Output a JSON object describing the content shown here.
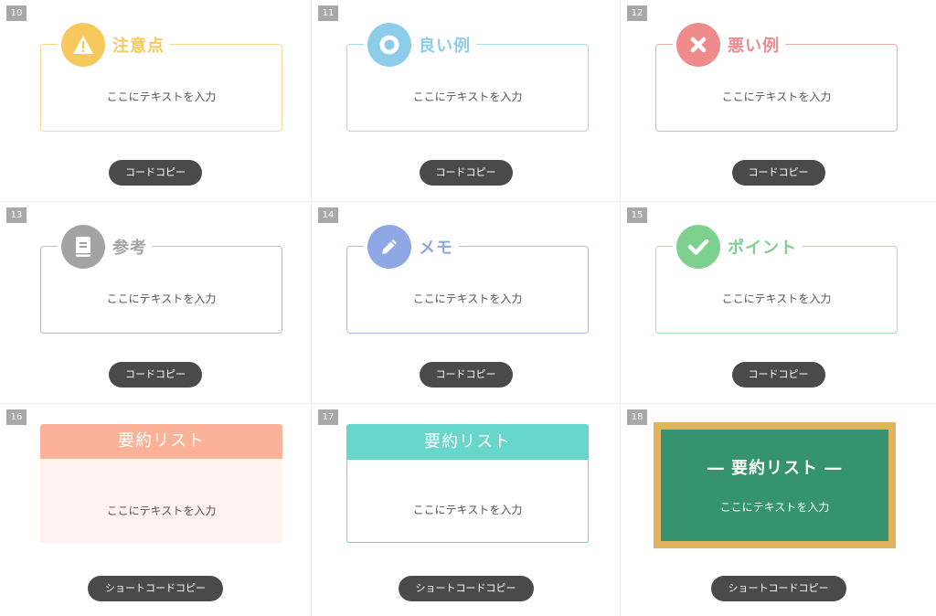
{
  "colors": {
    "caution": "#f7c95c",
    "good": "#8dcde9",
    "bad": "#ef8b8b",
    "reference": "#a3a3a3",
    "memo": "#8ea8e6",
    "point": "#7ed08e",
    "summary_salmon": "#fcb199",
    "summary_salmon_bg": "#fff2ef",
    "summary_teal": "#67d6cb",
    "board_green": "#369370",
    "board_frame": "#e2b35f",
    "button_bg": "#4a4a4a",
    "number_badge": "#a8a8a8"
  },
  "cards": [
    {
      "number": "10",
      "title": "注意点",
      "icon": "warning-icon",
      "body": "ここにテキストを入力",
      "button": "コードコピー"
    },
    {
      "number": "11",
      "title": "良い例",
      "icon": "circle-ring-icon",
      "body": "ここにテキストを入力",
      "button": "コードコピー"
    },
    {
      "number": "12",
      "title": "悪い例",
      "icon": "cross-icon",
      "body": "ここにテキストを入力",
      "button": "コードコピー"
    },
    {
      "number": "13",
      "title": "参考",
      "icon": "book-icon",
      "body": "ここにテキストを入力",
      "button": "コードコピー"
    },
    {
      "number": "14",
      "title": "メモ",
      "icon": "pencil-icon",
      "body": "ここにテキストを入力",
      "button": "コードコピー"
    },
    {
      "number": "15",
      "title": "ポイント",
      "icon": "check-icon",
      "body": "ここにテキストを入力",
      "button": "コードコピー"
    },
    {
      "number": "16",
      "title": "要約リスト",
      "body": "ここにテキストを入力",
      "button": "ショートコードコピー"
    },
    {
      "number": "17",
      "title": "要約リスト",
      "body": "ここにテキストを入力",
      "button": "ショートコードコピー"
    },
    {
      "number": "18",
      "title": "― 要約リスト ―",
      "body": "ここにテキストを入力",
      "button": "ショートコードコピー"
    }
  ]
}
